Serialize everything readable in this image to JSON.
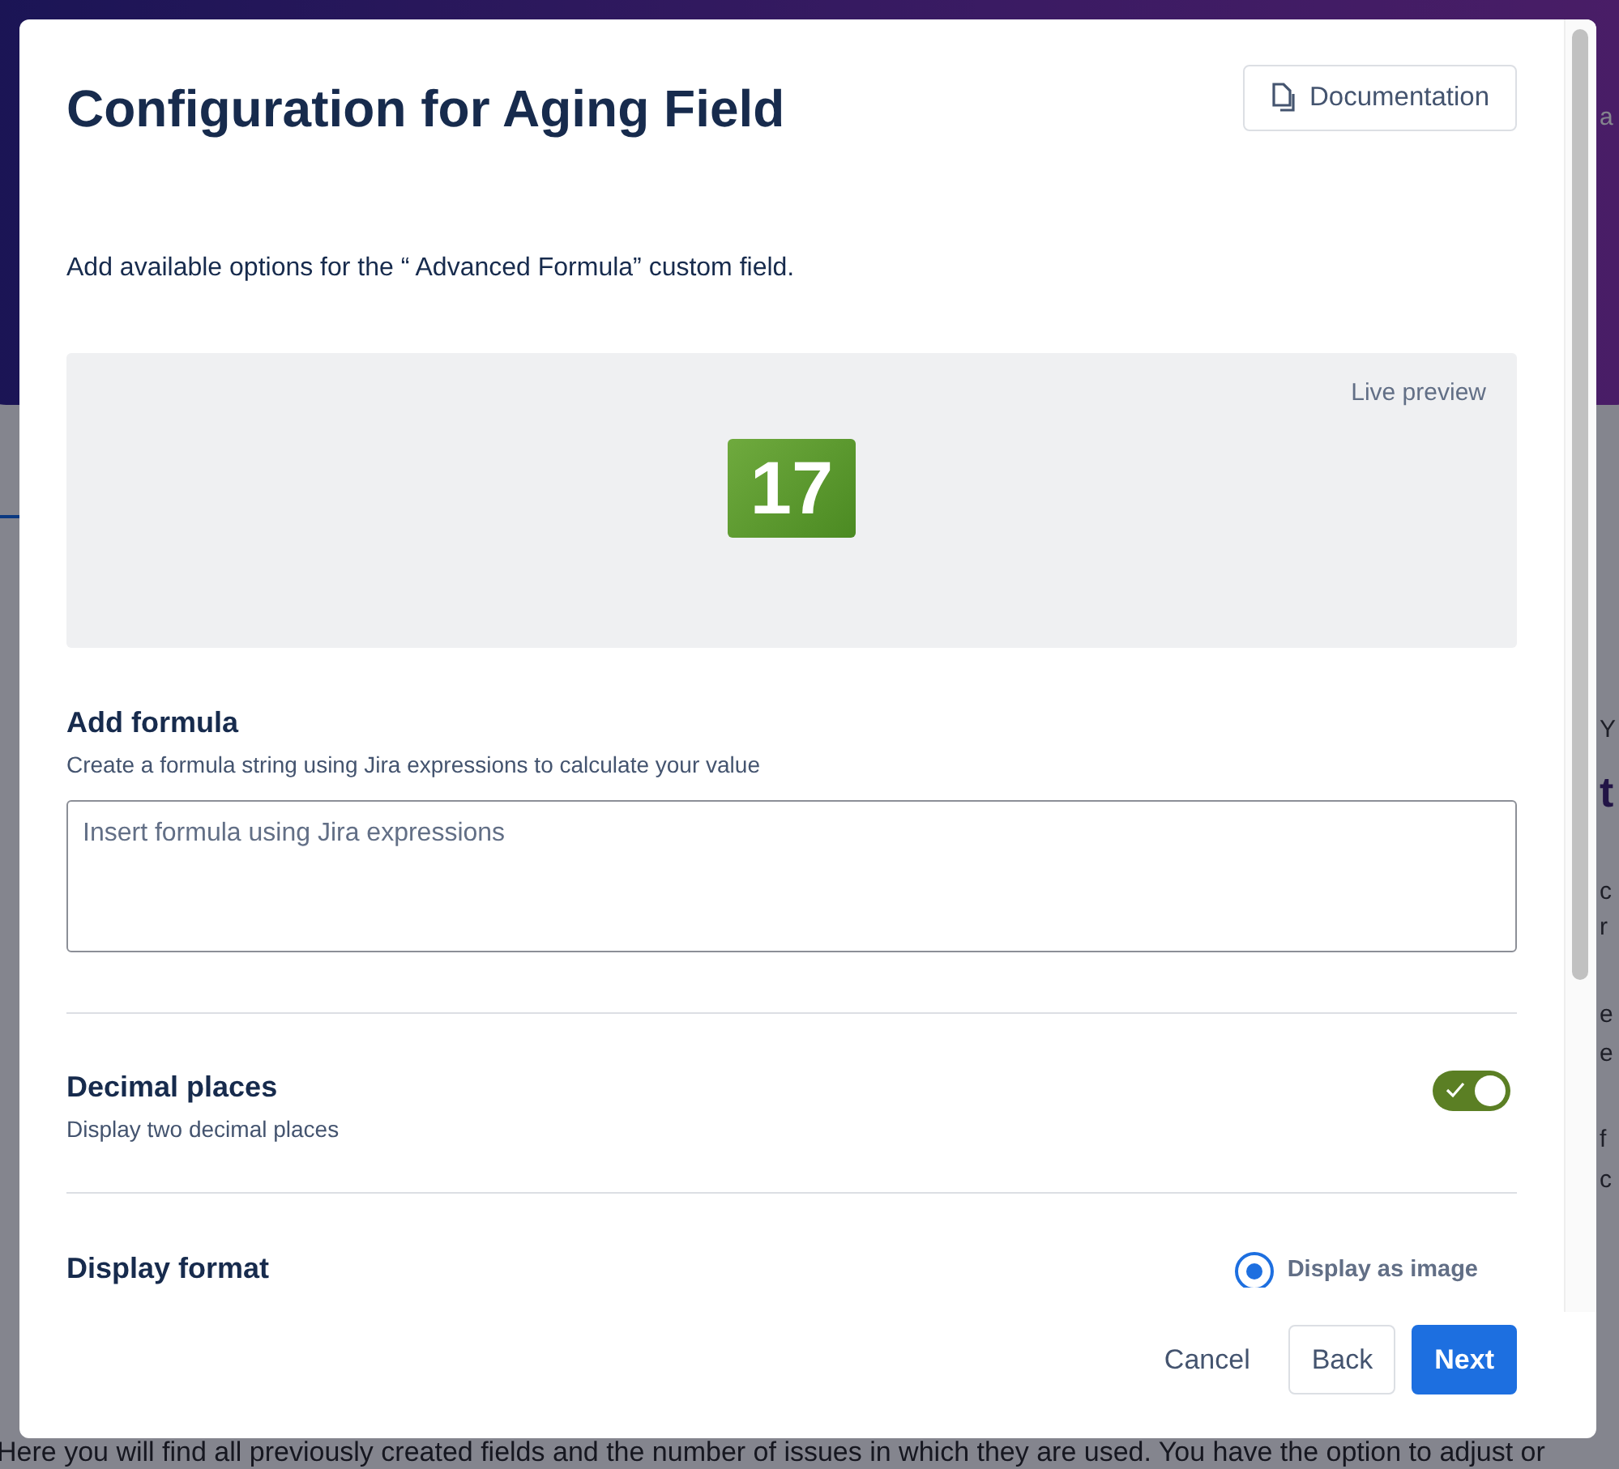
{
  "background": {
    "top_right_text": "a",
    "side_lines": [
      "Y",
      "t",
      "c",
      "r",
      "e",
      "e",
      "f",
      "c"
    ],
    "description": "Here you will find all previously created fields and the number of issues in which they are used. You have the option to adjust or"
  },
  "dialog": {
    "title": "Configuration for Aging Field",
    "documentation_button": "Documentation",
    "intro": "Add available options for the “ Advanced Formula” custom field.",
    "preview": {
      "label": "Live preview",
      "value": "17"
    },
    "formula": {
      "heading": "Add formula",
      "help": "Create a formula string using Jira expressions to calculate your value",
      "placeholder": "Insert formula using Jira expressions"
    },
    "decimal": {
      "heading": "Decimal places",
      "help": "Display two decimal places",
      "on": true
    },
    "display_format": {
      "heading": "Display format",
      "option": {
        "label": "Display as image",
        "selected": true
      }
    },
    "buttons": [
      {
        "label": "Cancel",
        "kind": "subtle"
      },
      {
        "label": "Back",
        "kind": "default"
      },
      {
        "label": "Next",
        "kind": "primary"
      }
    ]
  }
}
